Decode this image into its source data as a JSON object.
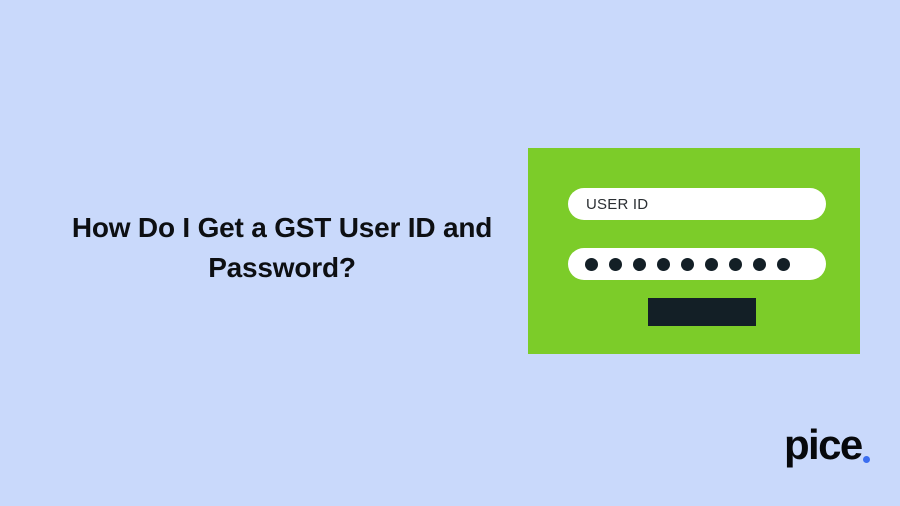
{
  "page": {
    "background_color": "#c9d9fb"
  },
  "headline": {
    "line1": "How Do I Get a GST User ID and",
    "line2": "Password?",
    "color": "#0d0f12"
  },
  "login_card": {
    "background_color": "#7ccc29",
    "user_id_field": {
      "value": "USER ID",
      "text_color": "#2b2f33",
      "background_color": "#ffffff"
    },
    "password_field": {
      "masked_value": "•••••••••",
      "dot_count": 9,
      "dot_color": "#131f26",
      "background_color": "#ffffff"
    },
    "submit_button": {
      "label": "",
      "color": "#131f26"
    }
  },
  "logo": {
    "word": "pice",
    "word_color": "#07090c",
    "dot_color": "#3b6ef0"
  }
}
